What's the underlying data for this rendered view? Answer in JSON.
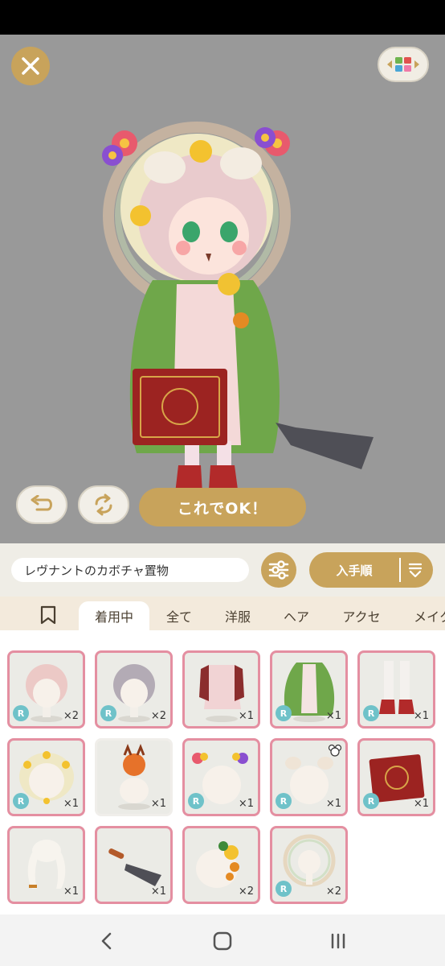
{
  "stage": {
    "ok_label": "これでOK！"
  },
  "search": {
    "item_name": "レヴナントのカボチャ置物",
    "sort_label": "入手順"
  },
  "tabs": [
    {
      "label": "着用中",
      "active": true
    },
    {
      "label": "全て",
      "active": false
    },
    {
      "label": "洋服",
      "active": false
    },
    {
      "label": "ヘア",
      "active": false
    },
    {
      "label": "アクセ",
      "active": false
    },
    {
      "label": "メイク",
      "active": false
    }
  ],
  "items": [
    {
      "icon": "pink-wig-item",
      "rarity": "R",
      "count": "×2"
    },
    {
      "icon": "gray-wig-item",
      "rarity": "R",
      "count": "×2"
    },
    {
      "icon": "red-coat-item",
      "rarity": "",
      "count": "×1"
    },
    {
      "icon": "green-cape-item",
      "rarity": "R",
      "count": "×1"
    },
    {
      "icon": "red-boots-item",
      "rarity": "R",
      "count": "×1"
    },
    {
      "icon": "flower-crown-item",
      "rarity": "R",
      "count": "×1"
    },
    {
      "icon": "pumpkin-ornament-item",
      "rarity": "",
      "count": "×1"
    },
    {
      "icon": "flower-hairpins-item",
      "rarity": "R",
      "count": "×1"
    },
    {
      "icon": "sheep-horns-item",
      "rarity": "R",
      "count": "×1",
      "favorite": true
    },
    {
      "icon": "red-book-item",
      "rarity": "R",
      "count": "×1"
    },
    {
      "icon": "gloves-item",
      "rarity": "",
      "count": "×1"
    },
    {
      "icon": "trowel-item",
      "rarity": "",
      "count": "×1"
    },
    {
      "icon": "flower-corsage-item",
      "rarity": "",
      "count": "×2"
    },
    {
      "icon": "rainbow-halo-item",
      "rarity": "R",
      "count": "×2"
    }
  ],
  "colors": {
    "gold": "#c8a35b",
    "stage_bg": "#999999",
    "card_border": "#e48fa1",
    "rarity_badge": "#6fc2c9"
  }
}
